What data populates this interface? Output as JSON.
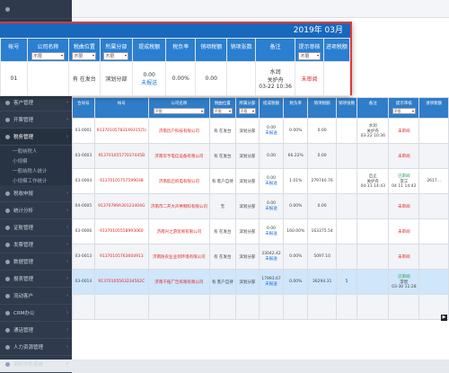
{
  "sidebar": {
    "items": [
      {
        "label": ""
      },
      {
        "label": ""
      },
      {
        "label": ""
      },
      {
        "label": ""
      },
      {
        "label": ""
      },
      {
        "label": "客户管理"
      },
      {
        "label": "开票管理"
      },
      {
        "label": "税务管理"
      },
      {
        "label": "一般纳税人"
      },
      {
        "label": "小规模"
      },
      {
        "label": "一般纳税人统计"
      },
      {
        "label": "小规模工作统计"
      },
      {
        "label": "税收申报"
      },
      {
        "label": "统计分析"
      },
      {
        "label": "证账管理"
      },
      {
        "label": "发票管理"
      },
      {
        "label": "数据管理"
      },
      {
        "label": "报表管理"
      },
      {
        "label": "流动客户"
      },
      {
        "label": "CRM办公"
      },
      {
        "label": "通话管理"
      },
      {
        "label": "人力资源管理"
      },
      {
        "label": "资料文件系统"
      }
    ]
  },
  "popup": {
    "header": "2019年 03月",
    "columns": [
      "帐号",
      "公司名称",
      "税曲位置",
      "所属分部",
      "提成税额",
      "税负率",
      "销项税额",
      "销项张数",
      "备注",
      "提示审核",
      "进项税额"
    ],
    "filters": {
      "company": "不限",
      "position": "不限",
      "branch": "不限",
      "audit": "不限"
    },
    "row": {
      "account": "01",
      "position": "有 在发台",
      "branch": "滨划分部",
      "amount": "0.00",
      "amount_link": "未报送",
      "rate": "0.00%",
      "output_tax": "0.00",
      "remark": "水润\n关护舟\n03-22 10:36",
      "audit": "未审阅"
    }
  },
  "grid": {
    "columns": [
      "合同号",
      "帐号",
      "公司名称",
      "税曲位置",
      "所属分部",
      "提成税额",
      "税负率",
      "销项税额",
      "销项张数",
      "备注",
      "提示审核",
      "进项税额"
    ],
    "filters": {
      "company": "不限",
      "position": "不限",
      "branch": "不限",
      "audit": "不限"
    },
    "rows": [
      {
        "contract": "03-0001",
        "account": "91370105783149315(5)",
        "company": "济南历户科技有限公司",
        "position": "有 在发台",
        "branch": "滨划分部",
        "amount": "0.00",
        "amount_link": "未报送",
        "rate": "0.00%",
        "output_tax": "0.00",
        "count": "",
        "remark": "水润\n关护舟\n03-22 10:36",
        "audit": "未审阅",
        "input_tax": ""
      },
      {
        "contract": "03-0003",
        "account": "91370105577037445B",
        "company": "济南华亨电信设备有限公司",
        "position": "有 在发台",
        "branch": "滨划分部",
        "amount": "0.00",
        "amount_link": "",
        "rate": "66.22%",
        "output_tax": "0.00",
        "count": "",
        "remark": "",
        "audit": "未审阅",
        "input_tax": ""
      },
      {
        "contract": "03-0004",
        "account": "91370105757599038",
        "company": "济南航启机电有限公司",
        "position": "有 客户自持",
        "branch": "滨划分部",
        "amount": "0.00",
        "amount_link": "未报送",
        "rate": "1.01%",
        "output_tax": "279740.76",
        "count": "",
        "remark": "启止\n关护舟\n04-11 14:43",
        "audit": "已审阅\n李工\n04 11 14:42",
        "input_tax": "2617..."
      },
      {
        "contract": "04-0005",
        "account": "91370789A30123404G",
        "company": "济南市二开大声供制料有限公司",
        "position": "无",
        "branch": "滨划分部",
        "amount": "0.00",
        "amount_link": "未报送",
        "rate": "0.00%",
        "output_tax": "0.00",
        "count": "",
        "remark": "",
        "audit": "未审阅",
        "input_tax": ""
      },
      {
        "contract": "03-0006",
        "account": "91370105558993060",
        "company": "济南兴之游贸易有限公司",
        "position": "有 在发台",
        "branch": "滨划分部",
        "amount": "0.00",
        "amount_link": "未报送",
        "rate": "160.00%",
        "output_tax": "163375.54",
        "count": "",
        "remark": "",
        "audit": "未审阅",
        "input_tax": ""
      },
      {
        "contract": "03-0013",
        "account": "91370105763604913",
        "company": "济南防农业业到环境有限公司",
        "position": "有 在发台",
        "branch": "滨划分部",
        "amount": "33042.42",
        "amount_link": "未报送",
        "rate": "0.00%",
        "output_tax": "5097.10",
        "count": "",
        "remark": "",
        "audit": "未审阅",
        "input_tax": ""
      },
      {
        "contract": "03-0014",
        "account": "91370105563234562C",
        "company": "济南千拓广告有限有限公司",
        "position": "有 客户自持",
        "branch": "滨划分部",
        "amount": "17993.67",
        "amount_link": "未报送",
        "rate": "0.00%",
        "output_tax": "36294.31",
        "count": "5",
        "remark": "",
        "audit": "已审阅\n李智\n03-30 11:28",
        "input_tax": ""
      },
      {
        "contract": "",
        "account": "",
        "company": "",
        "position": "",
        "branch": "",
        "amount": "",
        "amount_link": "",
        "rate": "",
        "output_tax": "",
        "count": "",
        "remark": "",
        "audit": "",
        "input_tax": ""
      }
    ]
  },
  "colors": {
    "sidebar": "#2f3b4c",
    "header": "#1868bd",
    "grid_header": "#2f7cc8",
    "highlight": "#e53935"
  }
}
